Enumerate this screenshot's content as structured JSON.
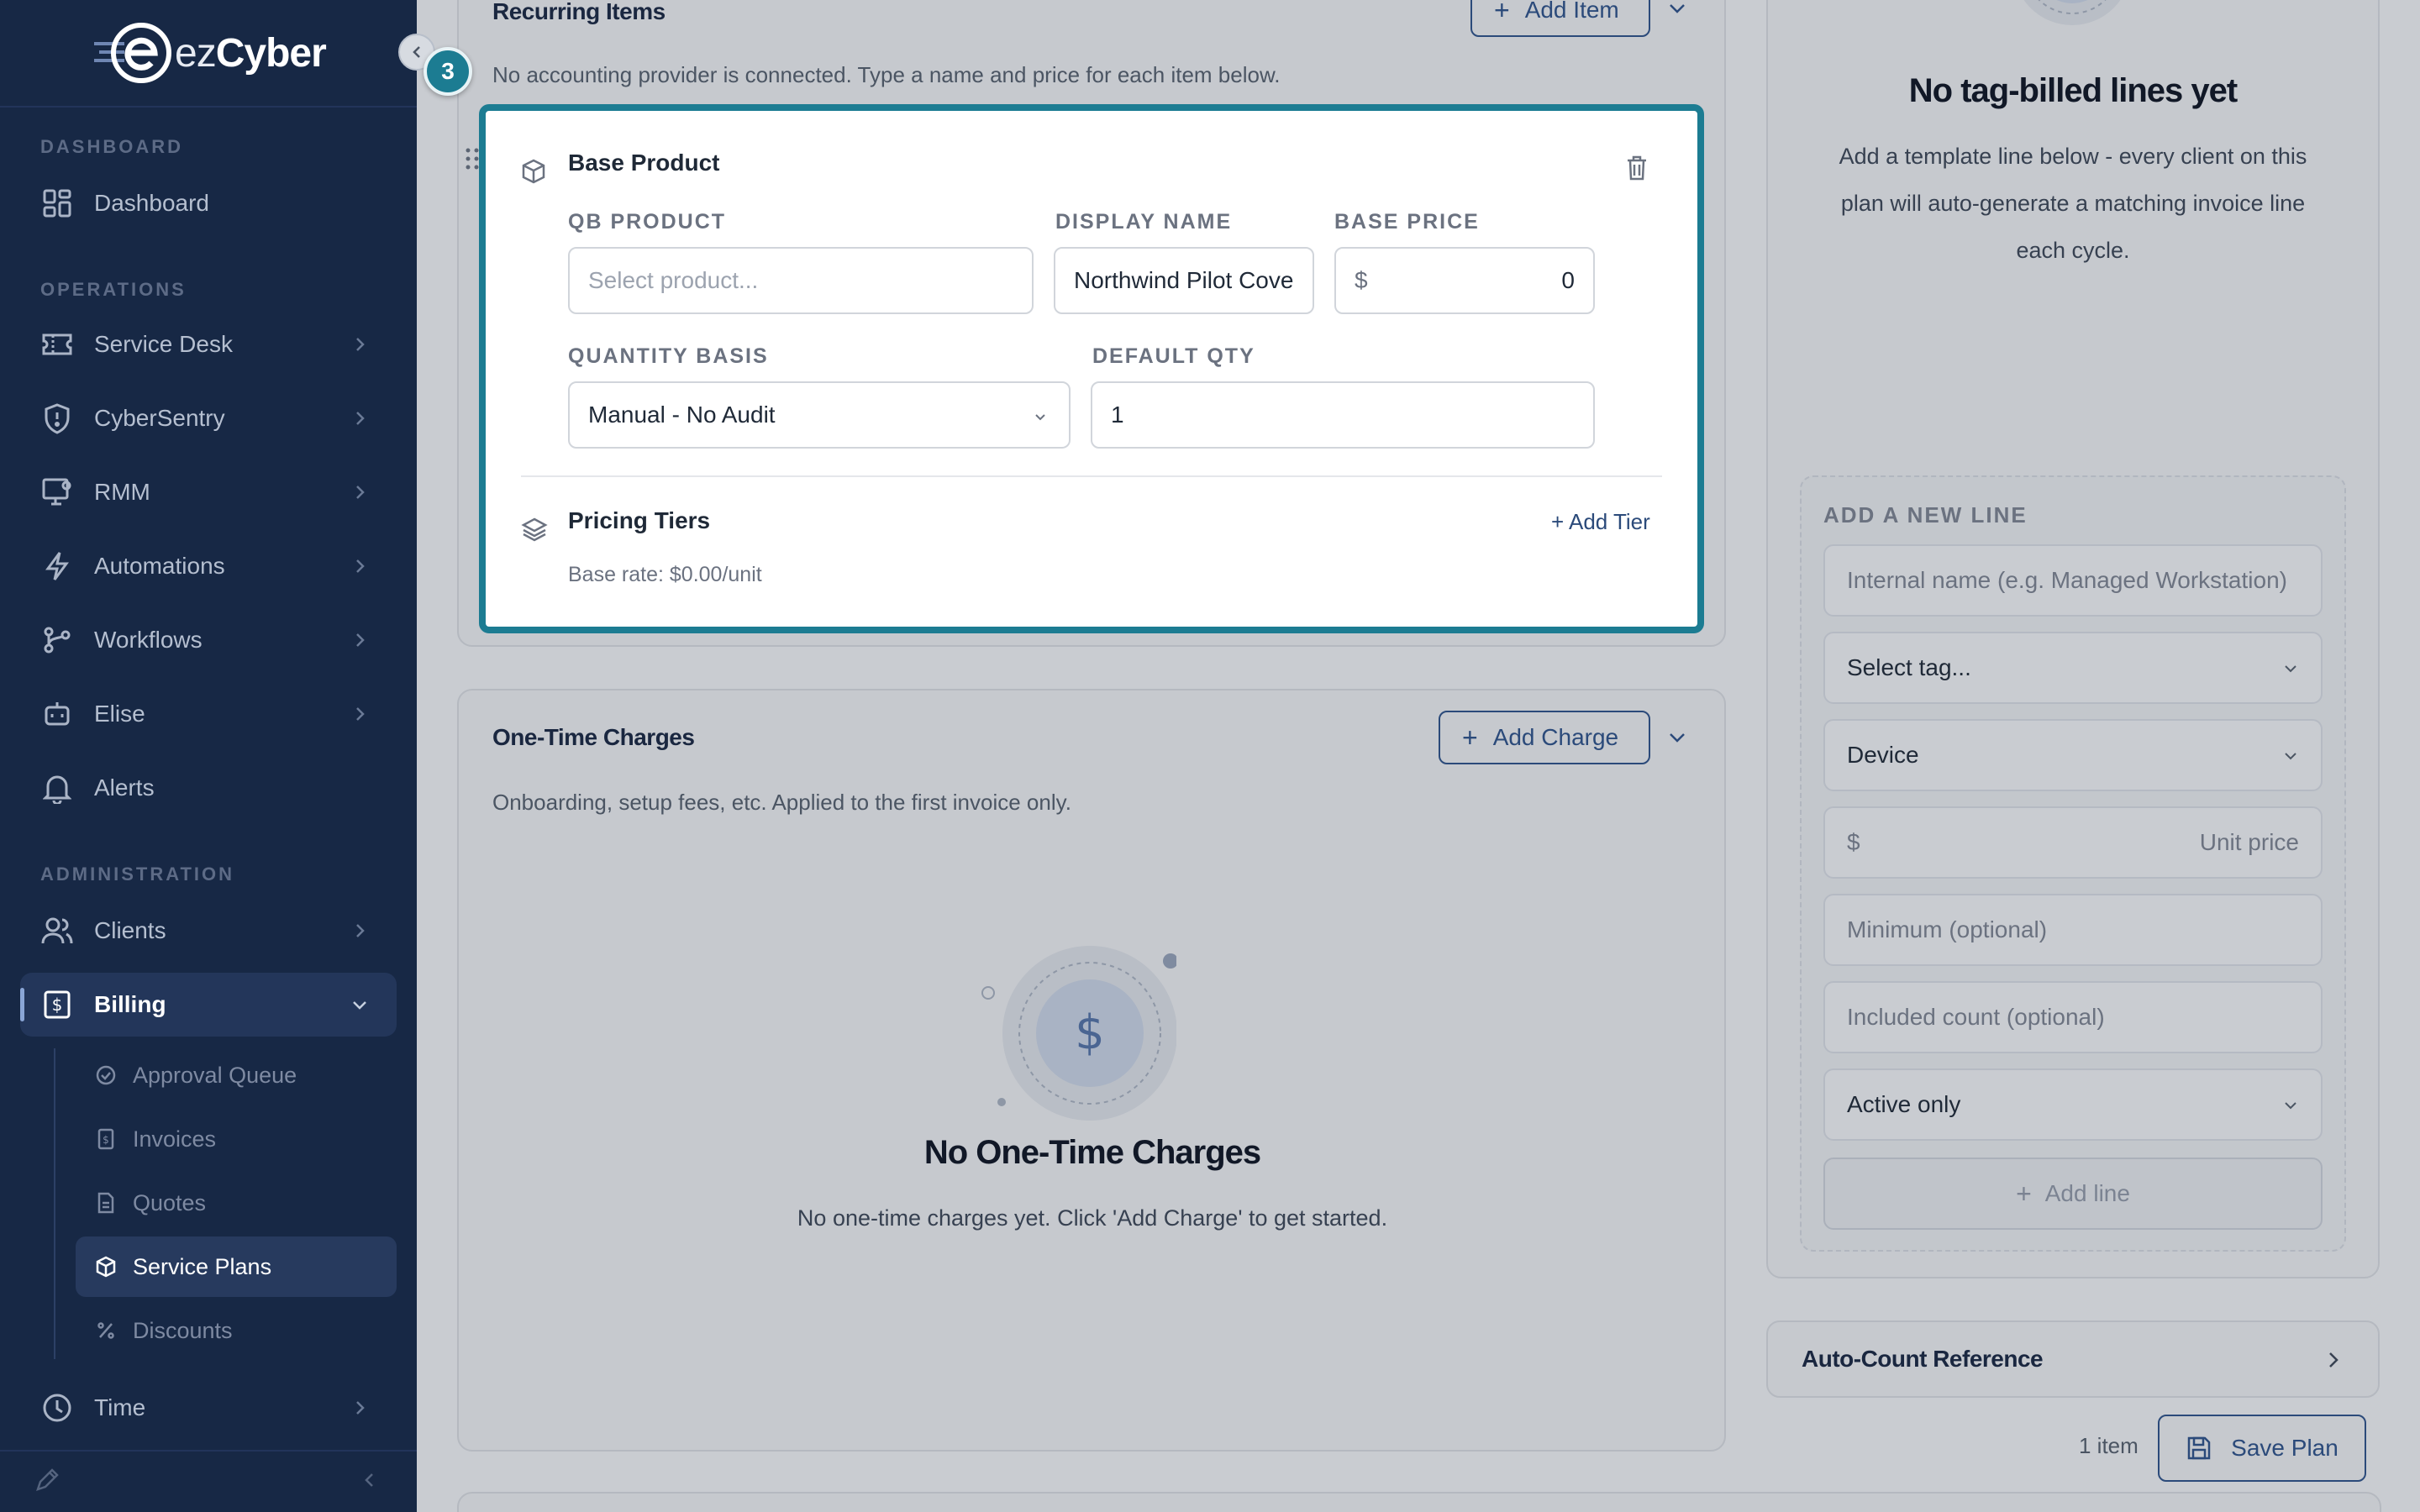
{
  "brand": {
    "logo_text_a": "ez",
    "logo_text_b": "Cyber"
  },
  "sidebar": {
    "sections": {
      "dashboard": "DASHBOARD",
      "operations": "OPERATIONS",
      "administration": "ADMINISTRATION"
    },
    "items": {
      "dashboard": "Dashboard",
      "service_desk": "Service Desk",
      "cybersentry": "CyberSentry",
      "rmm": "RMM",
      "automations": "Automations",
      "workflows": "Workflows",
      "elise": "Elise",
      "alerts": "Alerts",
      "clients": "Clients",
      "billing": "Billing",
      "time": "Time"
    },
    "billing_sub": {
      "approval_queue": "Approval Queue",
      "invoices": "Invoices",
      "quotes": "Quotes",
      "service_plans": "Service Plans",
      "discounts": "Discounts"
    }
  },
  "step_badge": "3",
  "recurring": {
    "title": "Recurring Items",
    "add_button": "Add Item",
    "subtitle": "No accounting provider is connected. Type a name and price for each item below.",
    "card": {
      "title": "Base Product",
      "qb_product_label": "QB PRODUCT",
      "qb_product_placeholder": "Select product...",
      "display_name_label": "DISPLAY NAME",
      "display_name_value": "Northwind Pilot Cove",
      "base_price_label": "BASE PRICE",
      "base_price_currency": "$",
      "base_price_value": "0",
      "quantity_basis_label": "QUANTITY BASIS",
      "quantity_basis_value": "Manual - No Audit",
      "default_qty_label": "DEFAULT QTY",
      "default_qty_value": "1",
      "pricing_tiers_title": "Pricing Tiers",
      "add_tier": "+ Add Tier",
      "base_rate": "Base rate: $0.00/unit"
    }
  },
  "onetime": {
    "title": "One-Time Charges",
    "add_button": "Add Charge",
    "subtitle": "Onboarding, setup fees, etc. Applied to the first invoice only.",
    "empty_glyph": "$",
    "empty_title": "No One-Time Charges",
    "empty_sub": "No one-time charges yet. Click 'Add Charge' to get started."
  },
  "tag_billed": {
    "empty_title": "No tag-billed lines yet",
    "empty_sub": "Add a template line below - every client on this plan will auto-generate a matching invoice line each cycle.",
    "add_line_title": "ADD A NEW LINE",
    "internal_name_placeholder": "Internal name (e.g. Managed Workstation)",
    "tag_select": "Select tag...",
    "type_select": "Device",
    "currency": "$",
    "unit_price_placeholder": "Unit price",
    "minimum_placeholder": "Minimum (optional)",
    "included_placeholder": "Included count (optional)",
    "status_select": "Active only",
    "add_line_button": "Add line"
  },
  "auto_count": "Auto-Count Reference",
  "footer": {
    "item_count": "1 item",
    "save_button": "Save Plan"
  },
  "colors": {
    "accent": "#1c7c92",
    "sidebar_bg": "#172845",
    "primary_text": "#2b4a7a"
  }
}
